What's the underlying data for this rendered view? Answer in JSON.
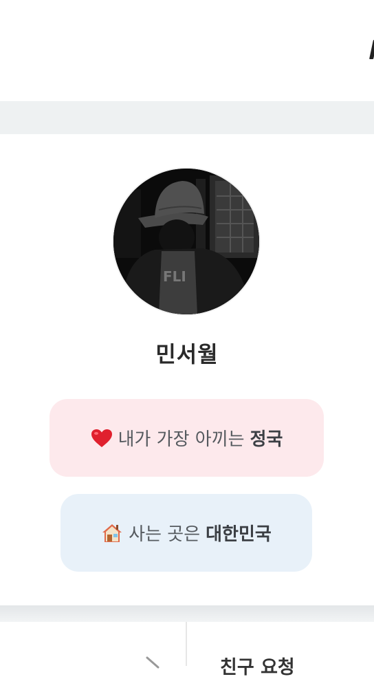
{
  "profile": {
    "name": "민서월",
    "avatar_icon": "profile-photo",
    "favorite": {
      "icon": "heart-icon",
      "prefix": "내가 가장 아끼는",
      "value": "정국",
      "background": "#fde9ec"
    },
    "home": {
      "icon": "house-icon",
      "prefix": "사는 곳은",
      "value": "대한민국",
      "background": "#e8f1f9"
    }
  },
  "bottom_tabs": {
    "right_label": "친구 요청"
  }
}
